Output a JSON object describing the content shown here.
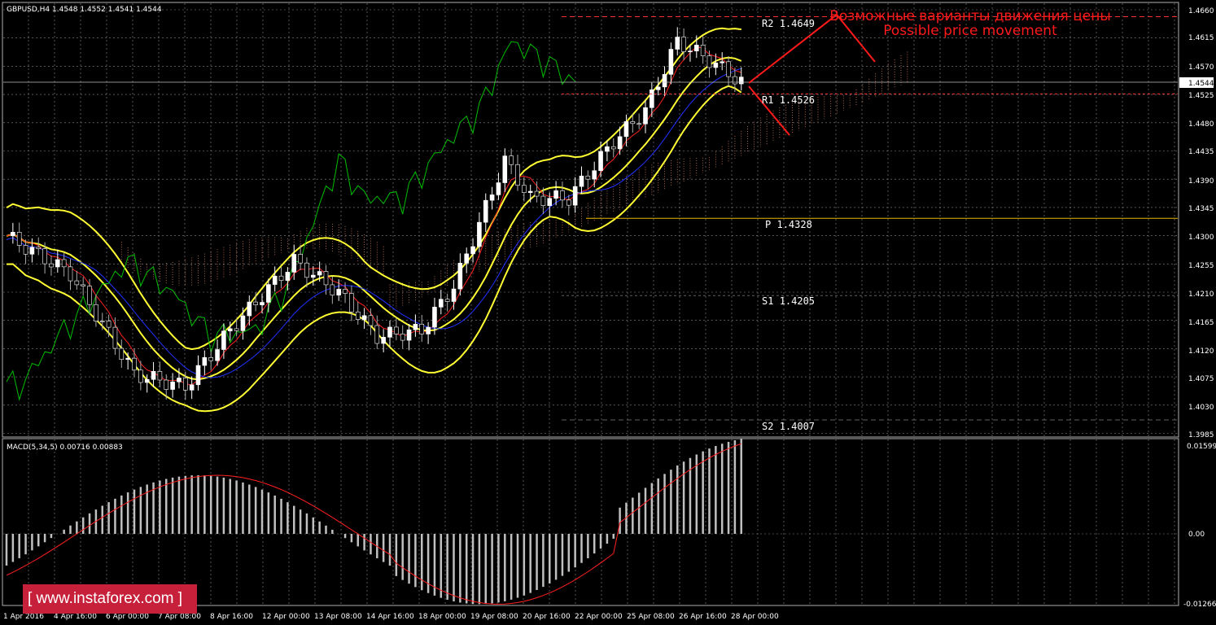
{
  "symbol_header": "GBPUSD,H4  1.4548 1.4552 1.4541 1.4544",
  "macd_header": "MACD(5,34,5) 0.00716 0.00883",
  "current_price": "1.4544",
  "annotation": {
    "ru": "Возможные варианты движения цены",
    "en": "Possible price movement"
  },
  "levels": [
    {
      "name": "R2",
      "value": "1.4649"
    },
    {
      "name": "R1",
      "value": "1.4526"
    },
    {
      "name": "P",
      "value": "1.4328"
    },
    {
      "name": "S1",
      "value": "1.4205"
    },
    {
      "name": "S2",
      "value": "1.4007"
    }
  ],
  "price_axis": [
    "1.4660",
    "1.4615",
    "1.4570",
    "1.4525",
    "1.4480",
    "1.4435",
    "1.4390",
    "1.4345",
    "1.4300",
    "1.4255",
    "1.4210",
    "1.4165",
    "1.4120",
    "1.4075",
    "1.4030",
    "1.3985"
  ],
  "macd_axis": [
    "0.01599",
    "0.00",
    "-0.01266"
  ],
  "time_axis": [
    "1 Apr 2016",
    "4 Apr 16:00",
    "6 Apr 00:00",
    "7 Apr 08:00",
    "8 Apr 16:00",
    "12 Apr 00:00",
    "13 Apr 08:00",
    "14 Apr 16:00",
    "18 Apr 00:00",
    "19 Apr 08:00",
    "20 Apr 16:00",
    "22 Apr 00:00",
    "25 Apr 08:00",
    "26 Apr 16:00",
    "28 Apr 00:00"
  ],
  "watermark": "[ www.instaforex.com ]",
  "colors": {
    "grid": "#8a8a8a",
    "bull": "#ffffff",
    "bear": "#5a5a5a",
    "bollinger": "#ffff33",
    "tenkan": "#ff2020",
    "kijun": "#2030ff",
    "chikou": "#00c000",
    "annotation": "#ff1a1a",
    "macd_hist": "#c0c0c0",
    "macd_signal": "#ff2020"
  }
}
